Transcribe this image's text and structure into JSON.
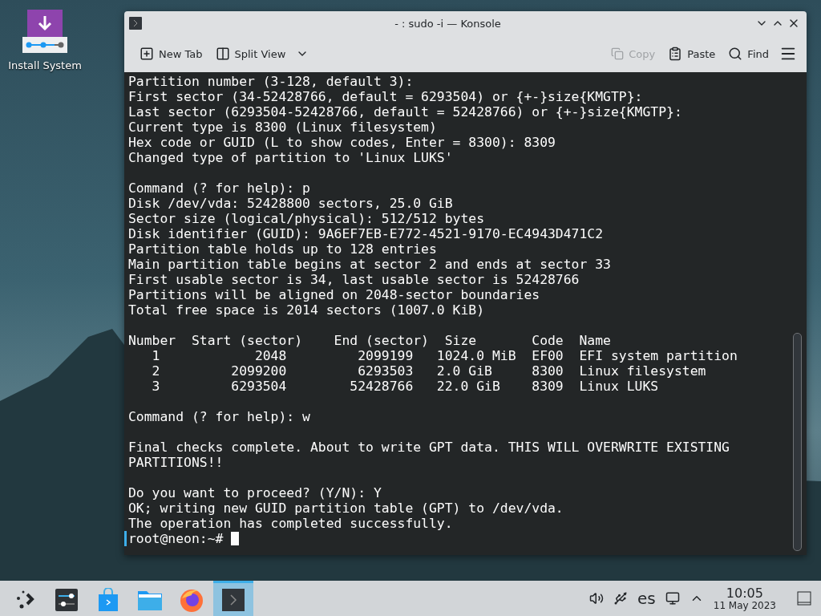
{
  "desktop_icons": [
    {
      "label": "Install System"
    }
  ],
  "window": {
    "title": "- : sudo -i — Konsole",
    "toolbar": [
      {
        "label": "New Tab",
        "kind": "newtab",
        "disabled": false
      },
      {
        "label": "Split View",
        "kind": "split",
        "disabled": false
      },
      {
        "label": "Copy",
        "kind": "copy",
        "disabled": true
      },
      {
        "label": "Paste",
        "kind": "paste",
        "disabled": false
      },
      {
        "label": "Find",
        "kind": "find",
        "disabled": false
      }
    ],
    "terminal": {
      "blocks": [
        [
          "Partition number (3-128, default 3):",
          "First sector (34-52428766, default = 6293504) or {+-}size{KMGTP}:",
          "Last sector (6293504-52428766, default = 52428766) or {+-}size{KMGTP}:",
          "Current type is 8300 (Linux filesystem)",
          "Hex code or GUID (L to show codes, Enter = 8300): 8309",
          "Changed type of partition to 'Linux LUKS'"
        ],
        [
          "Command (? for help): p",
          "Disk /dev/vda: 52428800 sectors, 25.0 GiB",
          "Sector size (logical/physical): 512/512 bytes",
          "Disk identifier (GUID): 9A6EF7EB-E772-4521-9170-EC4943D471C2",
          "Partition table holds up to 128 entries",
          "Main partition table begins at sector 2 and ends at sector 33",
          "First usable sector is 34, last usable sector is 52428766",
          "Partitions will be aligned on 2048-sector boundaries",
          "Total free space is 2014 sectors (1007.0 KiB)"
        ],
        [
          "Number  Start (sector)    End (sector)  Size       Code  Name",
          "   1            2048         2099199   1024.0 MiB  EF00  EFI system partition",
          "   2         2099200         6293503   2.0 GiB     8300  Linux filesystem",
          "   3         6293504        52428766   22.0 GiB    8309  Linux LUKS"
        ],
        [
          "Command (? for help): w"
        ],
        [
          "Final checks complete. About to write GPT data. THIS WILL OVERWRITE EXISTING",
          "PARTITIONS!!"
        ],
        [
          "Do you want to proceed? (Y/N): Y",
          "OK; writing new GUID partition table (GPT) to /dev/vda.",
          "The operation has completed successfully."
        ]
      ],
      "prompt": "root@neon:~#"
    }
  },
  "taskbar": {
    "items": [
      {
        "kind": "launcher",
        "selected": false
      },
      {
        "kind": "settings",
        "selected": false
      },
      {
        "kind": "store",
        "selected": false
      },
      {
        "kind": "files",
        "selected": false
      },
      {
        "kind": "firefox",
        "selected": false
      },
      {
        "kind": "terminal",
        "selected": true
      }
    ],
    "keyboard_layout": "es",
    "time": "10:05",
    "date": "11 May 2023"
  }
}
